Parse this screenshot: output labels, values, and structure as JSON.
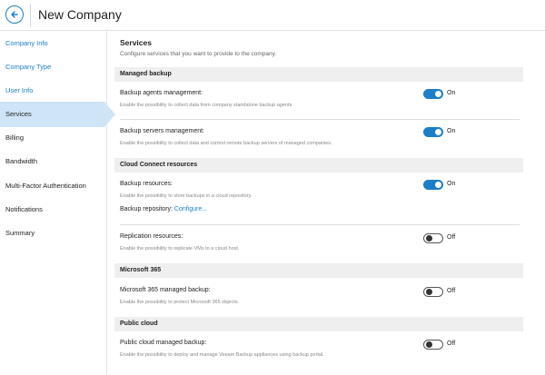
{
  "header": {
    "title": "New Company"
  },
  "sidebar": {
    "items": [
      {
        "label": "Company Info"
      },
      {
        "label": "Company Type"
      },
      {
        "label": "User Info"
      },
      {
        "label": "Services"
      },
      {
        "label": "Billing"
      },
      {
        "label": "Bandwidth"
      },
      {
        "label": "Multi-Factor Authentication"
      },
      {
        "label": "Notifications"
      },
      {
        "label": "Summary"
      }
    ],
    "active_item": "Services"
  },
  "main": {
    "title": "Services",
    "description": "Configure services that you want to provide to the company.",
    "sections": [
      {
        "header": "Managed backup"
      },
      {
        "header": "Cloud Connect resources"
      },
      {
        "header": "Microsoft 365"
      },
      {
        "header": "Public cloud"
      }
    ],
    "settings": {
      "backup_agents": {
        "label": "Backup agents management:",
        "hint": "Enable the possibility to collect data from company standalone backup agents.",
        "state": "On"
      },
      "backup_servers": {
        "label": "Backup servers management:",
        "hint": "Enable the possibility to collect data and control remote backup servers of managed companies.",
        "state": "On"
      },
      "backup_resources": {
        "label": "Backup resources:",
        "hint": "Enable the possibility to store backups in a cloud repository.",
        "state": "On"
      },
      "backup_repository": {
        "label": "Backup repository:",
        "link": "Configure..."
      },
      "replication_resources": {
        "label": "Replication resources:",
        "hint": "Enable the possibility to replicate VMs to a cloud host.",
        "state": "Off"
      },
      "m365_backup": {
        "label": "Microsoft 365 managed backup:",
        "hint": "Enable the possibility to protect Microsoft 365 objects.",
        "state": "Off"
      },
      "public_cloud_backup": {
        "label": "Public cloud managed backup:",
        "hint": "Enable the possibility to deploy and manage Veeam Backup appliances using backup portal.",
        "state": "Off"
      }
    }
  },
  "colors": {
    "accent": "#1c7ec9",
    "active_nav_bg": "#cfe5f7",
    "section_bg": "#efefef"
  },
  "icons": {
    "back": "arrow-left-circle-icon"
  }
}
